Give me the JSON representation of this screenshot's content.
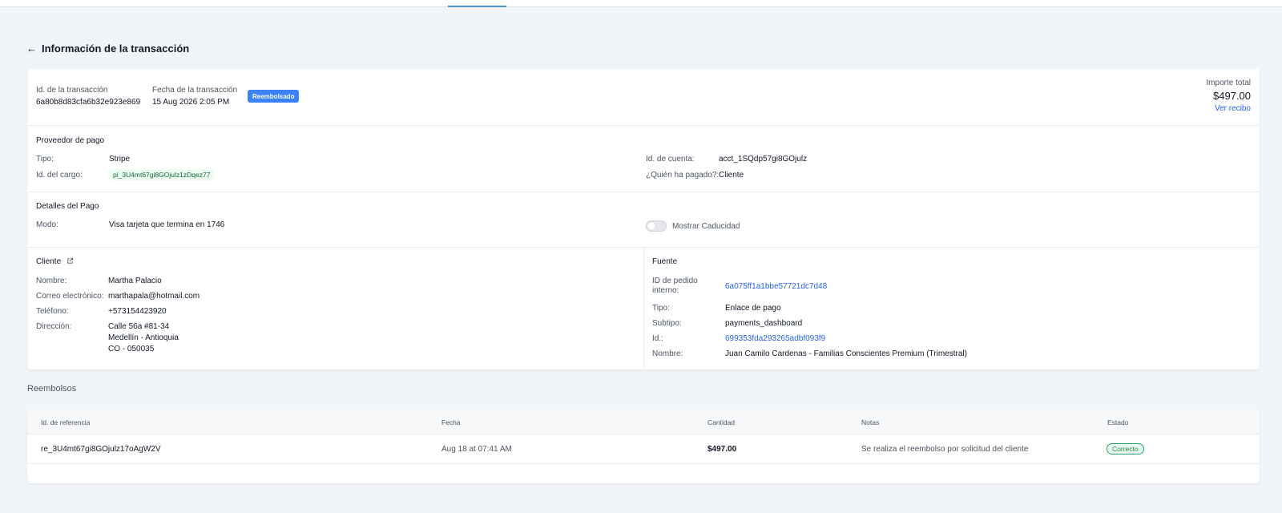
{
  "page": {
    "title": "Información de la transacción"
  },
  "transaction": {
    "id_label": "Id. de la transacción",
    "id_value": "6a80b8d83cfa6b32e923e869",
    "date_label": "Fecha de la transacción",
    "date_value": "15 Aug 2026 2:05 PM",
    "status_badge": "Reembolsado",
    "total_label": "Importe total",
    "total_value": "$497.00",
    "receipt_link": "Ver recibo"
  },
  "provider": {
    "title": "Proveedor de pago",
    "type_label": "Tipo:",
    "type_value": "Stripe",
    "charge_label": "Id. del cargo:",
    "charge_value": "pi_3U4mt67gi8GOjulz1zDqez77",
    "account_label": "Id. de cuenta:",
    "account_value": "acct_1SQdp57gi8GOjulz",
    "payer_label": "¿Quién ha pagado?:",
    "payer_value": "Cliente"
  },
  "payment_details": {
    "title": "Detalles del Pago",
    "mode_label": "Modo:",
    "mode_value": "Visa tarjeta que termina en 1746",
    "toggle_label": "Mostrar Caducidad",
    "toggle_on": false
  },
  "client": {
    "title": "Cliente",
    "name_label": "Nombre:",
    "name_value": "Martha Palacio",
    "email_label": "Correo electrónico:",
    "email_value": "marthapala@hotmail.com",
    "phone_label": "Teléfono:",
    "phone_value": "+573154423920",
    "address_label": "Dirección:",
    "address_line1": "Calle 56a #81-34",
    "address_line2": "Medellín - Antioquia",
    "address_line3": "CO - 050035"
  },
  "source": {
    "title": "Fuente",
    "order_label_1": "ID de pedido",
    "order_label_2": "interno:",
    "order_value": "6a075ff1a1bbe57721dc7d48",
    "type_label": "Tipo:",
    "type_value": "Enlace de pago",
    "subtype_label": "Subtipo:",
    "subtype_value": "payments_dashboard",
    "id_label": "Id.:",
    "id_value": "699353fda293265adbf093f9",
    "name_label": "Nombre:",
    "name_value": "Juan Camilo Cardenas - Familias Conscientes Premium (Trimestral)"
  },
  "refunds": {
    "heading": "Reembolsos",
    "columns": [
      "Id. de referencia",
      "Fecha",
      "Cantidad",
      "Notas",
      "Estado"
    ],
    "rows": [
      {
        "ref": "re_3U4mt67gi8GOjulz17oAgW2V",
        "date": "Aug 18 at 07:41 AM",
        "amount": "$497.00",
        "notes": "Se realiza el reembolso por solicitud del cliente",
        "status": "Correcto"
      }
    ]
  },
  "icons": {
    "back": "arrow-left-icon",
    "external": "external-link-icon"
  },
  "colors": {
    "accent": "#3b82f6",
    "link": "#2563eb",
    "success": "#16803c",
    "background": "#f2f5f8"
  }
}
